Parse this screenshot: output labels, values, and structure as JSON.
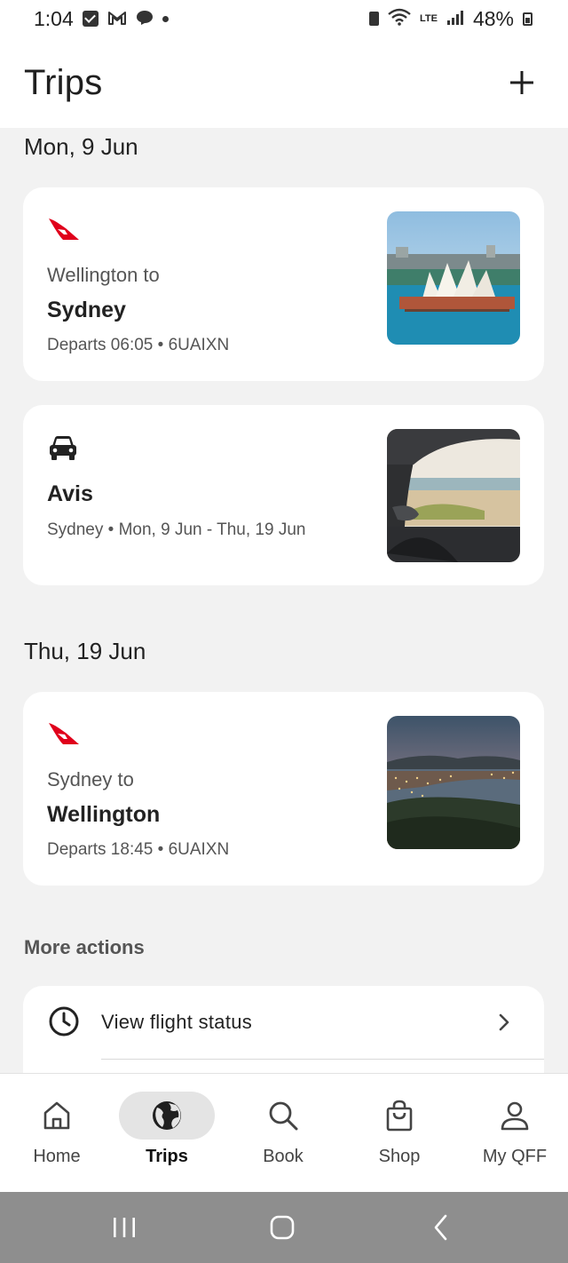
{
  "status_bar": {
    "time": "1:04",
    "network": "LTE",
    "battery": "48%"
  },
  "header": {
    "title": "Trips",
    "add_icon": "plus-icon"
  },
  "trips": [
    {
      "date": "Mon, 9 Jun",
      "items": [
        {
          "type": "flight",
          "icon": "qantas-logo",
          "from_text": "Wellington to",
          "destination": "Sydney",
          "meta": "Departs 06:05 • 6UAIXN",
          "image": "sydney-opera-house"
        },
        {
          "type": "car",
          "icon": "car-icon",
          "title": "Avis",
          "meta": "Sydney • Mon, 9 Jun - Thu, 19 Jun",
          "image": "car-window-beach"
        }
      ]
    },
    {
      "date": "Thu, 19 Jun",
      "items": [
        {
          "type": "flight",
          "icon": "qantas-logo",
          "from_text": "Sydney to",
          "destination": "Wellington",
          "meta": "Departs 18:45 • 6UAIXN",
          "image": "wellington-harbour"
        }
      ]
    }
  ],
  "more_actions": {
    "label": "More actions",
    "items": [
      {
        "label": "View flight status",
        "icon": "clock-icon"
      }
    ]
  },
  "bottom_nav": [
    {
      "label": "Home",
      "icon": "home-icon",
      "active": false
    },
    {
      "label": "Trips",
      "icon": "globe-icon",
      "active": true
    },
    {
      "label": "Book",
      "icon": "search-icon",
      "active": false
    },
    {
      "label": "Shop",
      "icon": "shopping-bag-icon",
      "active": false
    },
    {
      "label": "My QFF",
      "icon": "person-icon",
      "active": false
    }
  ],
  "colors": {
    "brand_red": "#e0001b",
    "background": "#f2f2f2",
    "card": "#ffffff",
    "active_pill": "#e4e4e4"
  }
}
